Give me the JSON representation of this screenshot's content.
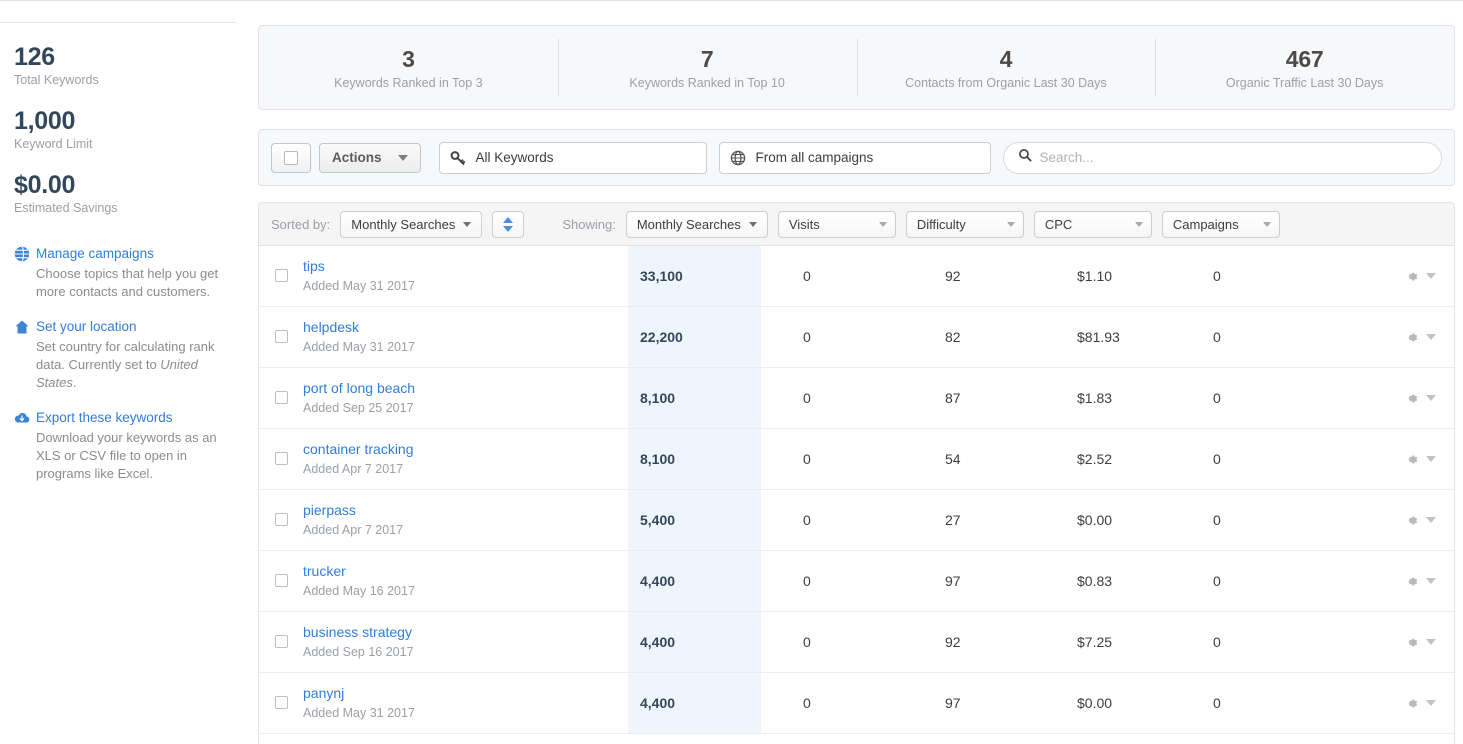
{
  "sidebar": {
    "stats": [
      {
        "value": "126",
        "label": "Total Keywords"
      },
      {
        "value": "1,000",
        "label": "Keyword Limit"
      },
      {
        "value": "$0.00",
        "label": "Estimated Savings"
      }
    ],
    "links": [
      {
        "icon": "globe-icon",
        "title": "Manage campaigns",
        "desc": "Choose topics that help you get more contacts and customers."
      },
      {
        "icon": "home-icon",
        "title": "Set your location",
        "desc_before": "Set country for calculating rank data. Currently set to ",
        "desc_em": "United States",
        "desc_after": "."
      },
      {
        "icon": "cloud-download-icon",
        "title": "Export these keywords",
        "desc": "Download your keywords as an XLS or CSV file to open in programs like Excel."
      }
    ]
  },
  "stat_cards": [
    {
      "value": "3",
      "label": "Keywords Ranked in Top 3"
    },
    {
      "value": "7",
      "label": "Keywords Ranked in Top 10"
    },
    {
      "value": "4",
      "label": "Contacts from Organic Last 30 Days"
    },
    {
      "value": "467",
      "label": "Organic Traffic Last 30 Days"
    }
  ],
  "toolbar": {
    "actions_label": "Actions",
    "keyword_filter": "All Keywords",
    "campaign_filter": "From all campaigns",
    "search_placeholder": "Search...",
    "search_value": ""
  },
  "filter_bar": {
    "sorted_by_label": "Sorted by:",
    "sorted_by_value": "Monthly Searches",
    "showing_label": "Showing:",
    "showing_values": [
      "Monthly Searches",
      "Visits",
      "Difficulty",
      "CPC",
      "Campaigns"
    ]
  },
  "table": {
    "rows": [
      {
        "keyword": "tips",
        "added": "Added May 31 2017",
        "monthly_searches": "33,100",
        "visits": "0",
        "difficulty": "92",
        "cpc": "$1.10",
        "campaigns": "0"
      },
      {
        "keyword": "helpdesk",
        "added": "Added May 31 2017",
        "monthly_searches": "22,200",
        "visits": "0",
        "difficulty": "82",
        "cpc": "$81.93",
        "campaigns": "0"
      },
      {
        "keyword": "port of long beach",
        "added": "Added Sep 25 2017",
        "monthly_searches": "8,100",
        "visits": "0",
        "difficulty": "87",
        "cpc": "$1.83",
        "campaigns": "0"
      },
      {
        "keyword": "container tracking",
        "added": "Added Apr 7 2017",
        "monthly_searches": "8,100",
        "visits": "0",
        "difficulty": "54",
        "cpc": "$2.52",
        "campaigns": "0"
      },
      {
        "keyword": "pierpass",
        "added": "Added Apr 7 2017",
        "monthly_searches": "5,400",
        "visits": "0",
        "difficulty": "27",
        "cpc": "$0.00",
        "campaigns": "0"
      },
      {
        "keyword": "trucker",
        "added": "Added May 16 2017",
        "monthly_searches": "4,400",
        "visits": "0",
        "difficulty": "97",
        "cpc": "$0.83",
        "campaigns": "0"
      },
      {
        "keyword": "business strategy",
        "added": "Added Sep 16 2017",
        "monthly_searches": "4,400",
        "visits": "0",
        "difficulty": "92",
        "cpc": "$7.25",
        "campaigns": "0"
      },
      {
        "keyword": "panynj",
        "added": "Added May 31 2017",
        "monthly_searches": "4,400",
        "visits": "0",
        "difficulty": "97",
        "cpc": "$0.00",
        "campaigns": "0"
      }
    ]
  },
  "colors": {
    "link_blue": "#2f7ed8",
    "accent_blue": "#4d90d9",
    "sorted_column_bg": "#eff5fc",
    "panel_bg": "#f7f8f9",
    "text_dark": "#33475b",
    "text_muted": "#9aa0a6"
  }
}
